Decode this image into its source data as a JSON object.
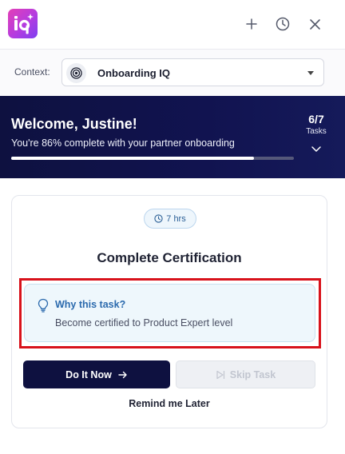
{
  "header": {
    "logo_text": "iq",
    "add_icon": "plus-icon",
    "history_icon": "clock-icon",
    "close_icon": "close-icon"
  },
  "context": {
    "label": "Context:",
    "value": "Onboarding IQ",
    "icon": "target-icon"
  },
  "banner": {
    "welcome": "Welcome, Justine!",
    "progress_text": "You're 86% complete with your partner onboarding",
    "progress_percent": 86,
    "count": "6/7",
    "count_label": "Tasks"
  },
  "task": {
    "time": "7 hrs",
    "title": "Complete Certification",
    "why_title": "Why this task?",
    "why_desc": "Become certified to Product Expert level",
    "do_label": "Do It Now",
    "skip_label": "Skip Task",
    "remind_label": "Remind me Later"
  },
  "colors": {
    "banner_bg": "#0e1140",
    "accent_link": "#2b6aad",
    "highlight": "#d8121b",
    "logo_pink": "#e33fb6",
    "logo_purple": "#7d3ff0"
  }
}
